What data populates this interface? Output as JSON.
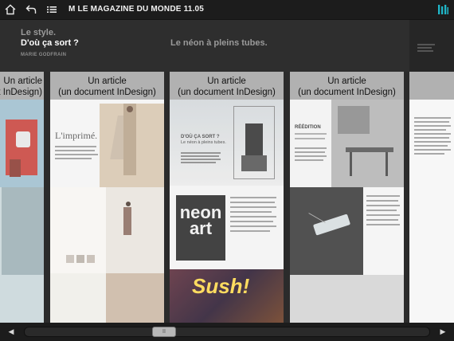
{
  "toolbar": {
    "title": "M LE MAGAZINE DU MONDE 11.05",
    "home_icon": "home-icon",
    "back_icon": "back-arrow-icon",
    "toc_icon": "list-icon",
    "logo_icon": "app-logo-icon"
  },
  "header": {
    "kicker": "Le style.",
    "title": "D'où ça sort ?",
    "author": "MARIE GODFRAIN",
    "second_title": "Le néon à pleins tubes."
  },
  "strips": {
    "label_partial": "Un article\n(un document InDesign)",
    "label_1": "Un article\n(un document InDesign)",
    "label_2": "Un article\n(un document InDesign)",
    "label_3": "Un article\n(un document InDesign)"
  },
  "pages": {
    "imprime_title": "L'imprimé.",
    "neon_kicker": "D'OÙ ÇA SORT ?",
    "neon_headline": "Le néon à pleins tubes.",
    "neon_sign": "neon art",
    "neon_sign_2": "Sush!",
    "reedition_title": "RÉÉDITION"
  },
  "bottom": {
    "prev_label": "◀",
    "next_label": "▶",
    "thumb_label": "II"
  }
}
